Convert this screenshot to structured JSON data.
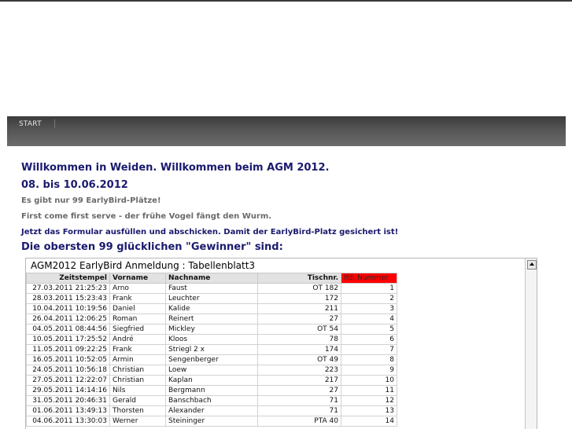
{
  "nav": {
    "start_label": "START"
  },
  "content": {
    "welcome": "Willkommen in Weiden. Willkommen beim AGM 2012.",
    "dates": "08. bis 10.06.2012",
    "earlybird_note": "Es gibt nur 99 EarlyBird-Plätze!",
    "first_come": "First come first serve - der frühe Vogel fängt den Wurm.",
    "form_note": "Jetzt das Formular ausfüllen und abschicken. Damit der EarlyBird-Platz gesichert ist!",
    "winners_heading": "Die obersten 99 glücklichen \"Gewinner\" sind:"
  },
  "sheet": {
    "title": "AGM2012 EarlyBird Anmeldung : Tabellenblatt3",
    "highlight_color": "#ff0000",
    "columns": [
      "Zeitstempel",
      "Vorname",
      "Nachname",
      "Tischnr.",
      "lfd. Nummer"
    ],
    "rows": [
      [
        "27.03.2011 21:25:23",
        "Arno",
        "Faust",
        "OT 182",
        "1"
      ],
      [
        "28.03.2011 15:23:43",
        "Frank",
        "Leuchter",
        "172",
        "2"
      ],
      [
        "10.04.2011 10:19:56",
        "Daniel",
        "Kalide",
        "211",
        "3"
      ],
      [
        "26.04.2011 12:06:25",
        "Roman",
        "Reinert",
        "27",
        "4"
      ],
      [
        "04.05.2011 08:44:56",
        "Siegfried",
        "Mickley",
        "OT 54",
        "5"
      ],
      [
        "10.05.2011 17:25:52",
        "André",
        "Kloos",
        "78",
        "6"
      ],
      [
        "11.05.2011 09:22:25",
        "Frank",
        "Striegl 2 x",
        "174",
        "7"
      ],
      [
        "16.05.2011 10:52:05",
        "Armin",
        "Sengenberger",
        "OT 49",
        "8"
      ],
      [
        "24.05.2011 10:56:18",
        "Christian",
        "Loew",
        "223",
        "9"
      ],
      [
        "27.05.2011 12:22:07",
        "Christian",
        "Kaplan",
        "217",
        "10"
      ],
      [
        "29.05.2011 14:14:16",
        "Nils",
        "Bergmann",
        "27",
        "11"
      ],
      [
        "31.05.2011 20:46:31",
        "Gerald",
        "Banschbach",
        "71",
        "12"
      ],
      [
        "01.06.2011 13:49:13",
        "Thorsten",
        "Alexander",
        "71",
        "13"
      ],
      [
        "04.06.2011 13:30:03",
        "Werner",
        "Steininger",
        "PTA 40",
        "14"
      ]
    ]
  }
}
